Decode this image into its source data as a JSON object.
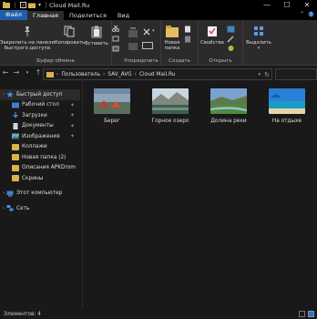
{
  "window": {
    "title": "Cloud Mail.Ru",
    "controls": {
      "minimize": "—",
      "maximize": "☐",
      "close": "✕"
    }
  },
  "tabs": {
    "file": "Файл",
    "home": "Главная",
    "share": "Поделиться",
    "view": "Вид"
  },
  "ribbon": {
    "pin_label": "Закрепить на панели быстрого доступа",
    "copy_label": "Копировать",
    "paste_label": "Вставить",
    "clipboard_group": "Буфер обмена",
    "organize_group": "Упорядочить",
    "new_folder_label": "Новая папка",
    "create_group": "Создать",
    "properties_label": "Свойства",
    "open_group": "Открыть",
    "select_label": "Выделить"
  },
  "address": {
    "crumbs": [
      "Пользователь",
      "SAV_AVG",
      "Cloud Mail.Ru"
    ]
  },
  "sidebar": {
    "items": [
      {
        "label": "Быстрый доступ"
      },
      {
        "label": "Рабочий стол"
      },
      {
        "label": "Загрузки"
      },
      {
        "label": "Документы"
      },
      {
        "label": "Изображения"
      },
      {
        "label": "Коллажи"
      },
      {
        "label": "Новая папка (2)"
      },
      {
        "label": "Описания  APKDrom"
      },
      {
        "label": "Скрины"
      },
      {
        "label": "Этот компьютер"
      },
      {
        "label": "Сеть"
      }
    ]
  },
  "files": [
    {
      "label": "Берег"
    },
    {
      "label": "Горное озеро"
    },
    {
      "label": "Долина реки"
    },
    {
      "label": "На отдыхе"
    }
  ],
  "status": {
    "count": "Элементов: 4"
  },
  "colors": {
    "accent": "#1f5fa8",
    "folder": "#d9b44a",
    "background": "#191919"
  }
}
